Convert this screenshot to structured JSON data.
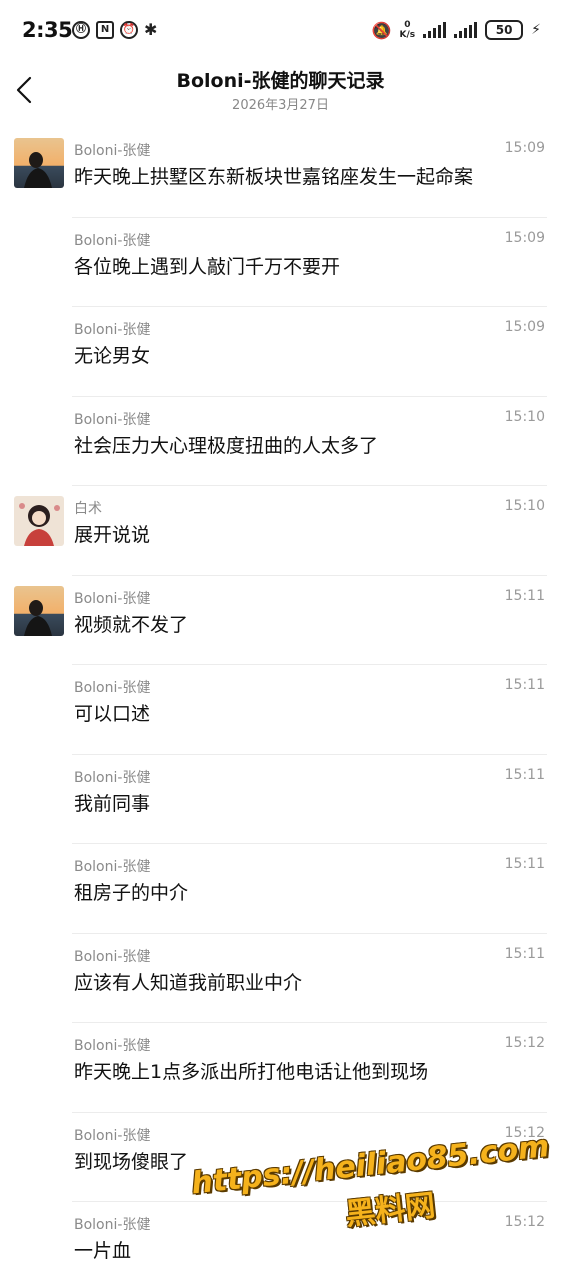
{
  "status_bar": {
    "time": "2:35",
    "net_speed_value": "0",
    "net_speed_unit": "K/s",
    "battery": "50",
    "icons": [
      "hd-icon",
      "nfc-icon",
      "alarm-icon",
      "bluetooth-icon",
      "mute-icon",
      "signal-icon",
      "battery-icon",
      "charging-icon"
    ]
  },
  "header": {
    "title": "Boloni-张健的聊天记录",
    "date": "2026年3月27日"
  },
  "messages": [
    {
      "sender": "Boloni-张健",
      "time": "15:09",
      "text": "昨天晚上拱墅区东新板块世嘉铭座发生一起命案",
      "avatar": "landscape"
    },
    {
      "sender": "Boloni-张健",
      "time": "15:09",
      "text": "各位晚上遇到人敲门千万不要开"
    },
    {
      "sender": "Boloni-张健",
      "time": "15:09",
      "text": "无论男女"
    },
    {
      "sender": "Boloni-张健",
      "time": "15:10",
      "text": "社会压力大心理极度扭曲的人太多了"
    },
    {
      "sender": "白术",
      "time": "15:10",
      "text": "展开说说",
      "avatar": "cartoon"
    },
    {
      "sender": "Boloni-张健",
      "time": "15:11",
      "text": "视频就不发了",
      "avatar": "landscape"
    },
    {
      "sender": "Boloni-张健",
      "time": "15:11",
      "text": "可以口述"
    },
    {
      "sender": "Boloni-张健",
      "time": "15:11",
      "text": "我前同事"
    },
    {
      "sender": "Boloni-张健",
      "time": "15:11",
      "text": "租房子的中介"
    },
    {
      "sender": "Boloni-张健",
      "time": "15:11",
      "text": "应该有人知道我前职业中介"
    },
    {
      "sender": "Boloni-张健",
      "time": "15:12",
      "text": "昨天晚上1点多派出所打他电话让他到现场"
    },
    {
      "sender": "Boloni-张健",
      "time": "15:12",
      "text": "到现场傻眼了"
    },
    {
      "sender": "Boloni-张健",
      "time": "15:12",
      "text": "一片血"
    }
  ],
  "watermark": {
    "url": "https://heiliao85.com",
    "label": "黑料网"
  }
}
